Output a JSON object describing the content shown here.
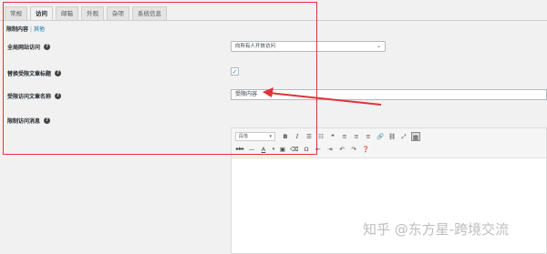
{
  "tabs": [
    {
      "label": "常规",
      "active": false
    },
    {
      "label": "访问",
      "active": true
    },
    {
      "label": "邮箱",
      "active": false
    },
    {
      "label": "外观",
      "active": false
    },
    {
      "label": "杂项",
      "active": false
    },
    {
      "label": "系统信息",
      "active": false
    }
  ],
  "subtabs": {
    "active": "限制内容",
    "separator": "|",
    "other": "其他"
  },
  "fields": {
    "global_access": {
      "label": "全局网站访问",
      "value": "向所有人开放访问"
    },
    "replace_title": {
      "label": "替换受限文章标题",
      "checked": true
    },
    "restricted_title": {
      "label": "受限访问文章名称",
      "value": "受限内容"
    },
    "restricted_message": {
      "label": "限制访问消息"
    }
  },
  "editor": {
    "format_select": "段落",
    "row1": [
      "bold",
      "italic",
      "bullet-list",
      "numbered-list",
      "blockquote",
      "align-left",
      "align-center",
      "align-right",
      "link",
      "unlink",
      "fullscreen",
      "toolbar-toggle"
    ],
    "row2": [
      "strikethrough",
      "horizontal-line",
      "text-color",
      "paste-text",
      "clear-formatting",
      "special-character",
      "outdent",
      "indent",
      "undo",
      "redo",
      "help"
    ]
  },
  "annotation_color": "#e0333a",
  "watermark": "知乎 @东方星-跨境交流"
}
